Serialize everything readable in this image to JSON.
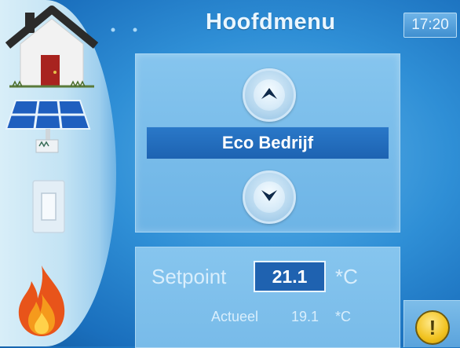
{
  "header": {
    "title": "Hoofdmenu",
    "time": "17:20"
  },
  "sidebar": {
    "items": [
      {
        "icon": "house-icon"
      },
      {
        "icon": "solar-panel-icon"
      },
      {
        "icon": "light-switch-icon"
      },
      {
        "icon": "flame-icon"
      }
    ]
  },
  "menu": {
    "mode_label": "Eco Bedrijf",
    "up_icon": "chevron-up-icon",
    "down_icon": "chevron-down-icon"
  },
  "setpoint": {
    "label": "Setpoint",
    "value": "21.1",
    "unit": "*C",
    "actual_label": "Actueel",
    "actual_value": "19.1",
    "actual_unit": "*C"
  },
  "alarm": {
    "symbol": "!"
  },
  "colors": {
    "background": "#2f8fd6",
    "panel": "#7fbfeb",
    "mode_bar": "#1f62b0",
    "alarm": "#f1c21f"
  }
}
